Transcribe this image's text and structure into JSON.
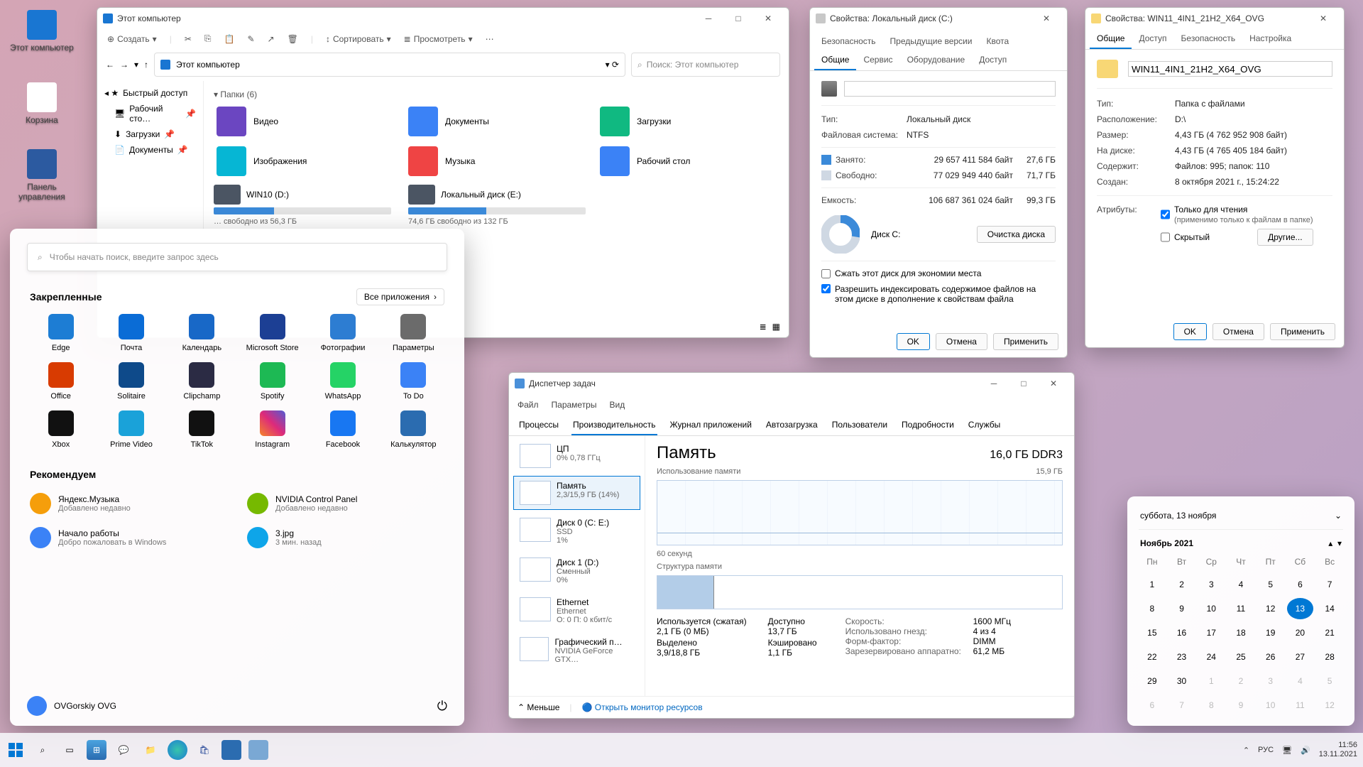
{
  "desktop": {
    "icons": [
      {
        "label": "Этот\nкомпьютер",
        "color": "#1976d2"
      },
      {
        "label": "Корзина",
        "color": "#eeeeee"
      },
      {
        "label": "Панель\nуправления",
        "color": "#2c5aa0"
      }
    ]
  },
  "explorer": {
    "title": "Этот компьютер",
    "new": "Создать",
    "sort": "Сортировать",
    "view": "Просмотреть",
    "crumb": "Этот компьютер",
    "search_placeholder": "Поиск: Этот компьютер",
    "nav": [
      "Быстрый доступ",
      "Рабочий сто…",
      "Загрузки",
      "Документы"
    ],
    "group_folders": "Папки (6)",
    "folders": [
      "Видео",
      "Документы",
      "Загрузки",
      "Изображения",
      "Музыка",
      "Рабочий стол"
    ],
    "drives": [
      {
        "name": "WIN10 (D:)",
        "free": "… свободно из 56,3 ГБ",
        "pct": 34
      },
      {
        "name": "Локальный диск (E:)",
        "free": "74,6 ГБ свободно из 132 ГБ",
        "pct": 44
      }
    ]
  },
  "propsC": {
    "title": "Свойства: Локальный диск (C:)",
    "tabs_top": [
      "Безопасность",
      "Предыдущие версии",
      "Квота"
    ],
    "tabs_bot": [
      "Общие",
      "Сервис",
      "Оборудование",
      "Доступ"
    ],
    "type_k": "Тип:",
    "type_v": "Локальный диск",
    "fs_k": "Файловая система:",
    "fs_v": "NTFS",
    "used_k": "Занято:",
    "used_b": "29 657 411 584 байт",
    "used_g": "27,6 ГБ",
    "free_k": "Свободно:",
    "free_b": "77 029 949 440 байт",
    "free_g": "71,7 ГБ",
    "cap_k": "Емкость:",
    "cap_b": "106 687 361 024 байт",
    "cap_g": "99,3 ГБ",
    "disk": "Диск C:",
    "clean": "Очистка диска",
    "cb1": "Сжать этот диск для экономии места",
    "cb2": "Разрешить индексировать содержимое файлов на этом диске в дополнение к свойствам файла",
    "ok": "OK",
    "cancel": "Отмена",
    "apply": "Применить"
  },
  "propsF": {
    "title": "Свойства: WIN11_4IN1_21H2_X64_OVG",
    "tabs": [
      "Общие",
      "Доступ",
      "Безопасность",
      "Настройка"
    ],
    "name": "WIN11_4IN1_21H2_X64_OVG",
    "rows": [
      [
        "Тип:",
        "Папка с файлами"
      ],
      [
        "Расположение:",
        "D:\\"
      ],
      [
        "Размер:",
        "4,43 ГБ (4 762 952 908 байт)"
      ],
      [
        "На диске:",
        "4,43 ГБ (4 765 405 184 байт)"
      ],
      [
        "Содержит:",
        "Файлов: 995; папок: 110"
      ],
      [
        "Создан:",
        "8 октября 2021 г., 15:24:22"
      ]
    ],
    "attrs": "Атрибуты:",
    "ro": "Только для чтения",
    "ro_sub": "(применимо только к файлам в папке)",
    "hidden": "Скрытый",
    "other": "Другие...",
    "ok": "OK",
    "cancel": "Отмена",
    "apply": "Применить"
  },
  "taskmgr": {
    "title": "Диспетчер задач",
    "menu": [
      "Файл",
      "Параметры",
      "Вид"
    ],
    "tabs": [
      "Процессы",
      "Производительность",
      "Журнал приложений",
      "Автозагрузка",
      "Пользователи",
      "Подробности",
      "Службы"
    ],
    "list": [
      {
        "name": "ЦП",
        "sub": "0% 0,78 ГГц"
      },
      {
        "name": "Память",
        "sub": "2,3/15,9 ГБ (14%)"
      },
      {
        "name": "Диск 0 (C: E:)",
        "sub": "SSD\n1%"
      },
      {
        "name": "Диск 1 (D:)",
        "sub": "Сменный\n0%"
      },
      {
        "name": "Ethernet",
        "sub": "Ethernet\nО: 0 П: 0 кбит/с"
      },
      {
        "name": "Графический п…",
        "sub": "NVIDIA GeForce GTX…"
      }
    ],
    "hd_left": "Память",
    "hd_right": "16,0 ГБ DDR3",
    "g1_l": "Использование памяти",
    "g1_r": "15,9 ГБ",
    "g1_b": "60 секунд",
    "g2_l": "Структура памяти",
    "stats": [
      [
        "Используется (сжатая)",
        "2,1 ГБ (0 МБ)"
      ],
      [
        "Доступно",
        "13,7 ГБ"
      ],
      [
        "Выделено",
        "3,9/18,8 ГБ"
      ],
      [
        "Кэшировано",
        "1,1 ГБ"
      ]
    ],
    "rstats": [
      [
        "Скорость:",
        "1600 МГц"
      ],
      [
        "Использовано гнезд:",
        "4 из 4"
      ],
      [
        "Форм-фактор:",
        "DIMM"
      ],
      [
        "Зарезервировано аппаратно:",
        "61,2 МБ"
      ]
    ],
    "less": "Меньше",
    "resmon": "Открыть монитор ресурсов"
  },
  "start": {
    "search": "Чтобы начать поиск, введите запрос здесь",
    "pinned_hd": "Закрепленные",
    "all": "Все приложения",
    "pinned": [
      {
        "n": "Edge",
        "c": "#1d7dd4"
      },
      {
        "n": "Почта",
        "c": "#0a6cd6"
      },
      {
        "n": "Календарь",
        "c": "#1868c7"
      },
      {
        "n": "Microsoft Store",
        "c": "#1c3f94"
      },
      {
        "n": "Фотографии",
        "c": "#2d7dd2"
      },
      {
        "n": "Параметры",
        "c": "#6b6b6b"
      },
      {
        "n": "Office",
        "c": "#d83b01"
      },
      {
        "n": "Solitaire",
        "c": "#0e4a8a"
      },
      {
        "n": "Clipchamp",
        "c": "#2b2b44"
      },
      {
        "n": "Spotify",
        "c": "#1db954"
      },
      {
        "n": "WhatsApp",
        "c": "#25d366"
      },
      {
        "n": "To Do",
        "c": "#3b82f6"
      },
      {
        "n": "Xbox",
        "c": "#111"
      },
      {
        "n": "Prime Video",
        "c": "#1aa2d9"
      },
      {
        "n": "TikTok",
        "c": "#111"
      },
      {
        "n": "Instagram",
        "c": "linear-gradient(45deg,#f58529,#dd2a7b,#515bd4)"
      },
      {
        "n": "Facebook",
        "c": "#1877f2"
      },
      {
        "n": "Калькулятор",
        "c": "#2b6cb0"
      }
    ],
    "rec_hd": "Рекомендуем",
    "rec": [
      {
        "t": "Яндекс.Музыка",
        "s": "Добавлено недавно"
      },
      {
        "t": "NVIDIA Control Panel",
        "s": "Добавлено недавно"
      },
      {
        "t": "Начало работы",
        "s": "Добро пожаловать в Windows"
      },
      {
        "t": "3.jpg",
        "s": "3 мин. назад"
      }
    ],
    "user": "OVGorskiy OVG"
  },
  "calendar": {
    "today_str": "суббота, 13 ноября",
    "month": "Ноябрь 2021",
    "dow": [
      "Пн",
      "Вт",
      "Ср",
      "Чт",
      "Пт",
      "Сб",
      "Вс"
    ],
    "days": [
      [
        1,
        2,
        3,
        4,
        5,
        6,
        7
      ],
      [
        8,
        9,
        10,
        11,
        12,
        13,
        14
      ],
      [
        15,
        16,
        17,
        18,
        19,
        20,
        21
      ],
      [
        22,
        23,
        24,
        25,
        26,
        27,
        28
      ],
      [
        29,
        30,
        1,
        2,
        3,
        4,
        5
      ],
      [
        6,
        7,
        8,
        9,
        10,
        11,
        12
      ]
    ],
    "today": 13
  },
  "taskbar": {
    "lang": "РУС",
    "time": "11:56",
    "date": "13.11.2021"
  },
  "chart_data": {
    "type": "pie",
    "title": "Диск C:",
    "series": [
      {
        "name": "Занято",
        "value": 27.6,
        "color": "#3b8ad9"
      },
      {
        "name": "Свободно",
        "value": 71.7,
        "color": "#cfd8e3"
      }
    ],
    "unit": "ГБ"
  }
}
